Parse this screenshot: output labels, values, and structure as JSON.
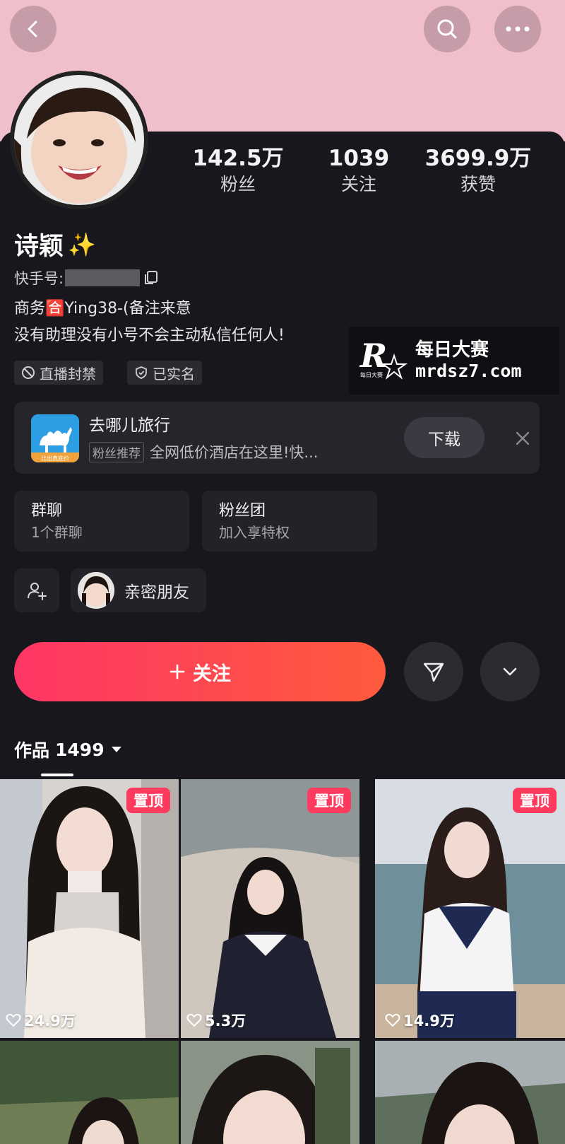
{
  "header": {
    "back_icon": "chevron-left-icon",
    "search_icon": "search-icon",
    "more_icon": "more-horizontal-icon"
  },
  "profile": {
    "stats": [
      {
        "value": "142.5万",
        "label": "粉丝"
      },
      {
        "value": "1039",
        "label": "关注"
      },
      {
        "value": "3699.9万",
        "label": "获赞"
      }
    ],
    "name": "诗颖",
    "name_emoji": "✨",
    "kuaishou_id_label": "快手号:",
    "bio_line1": "商务🈴Ying38-(备注来意",
    "bio_line2": "没有助理没有小号不会主动私信任何人!",
    "tags": [
      {
        "label": "直播封禁",
        "icon": "ban-icon"
      },
      {
        "label": "已实名",
        "icon": "shield-check-icon"
      }
    ]
  },
  "watermark": {
    "logo": "R",
    "logo_sub": "每日大赛",
    "title": "每日大赛",
    "url": "mrdsz7.com"
  },
  "ad": {
    "app_name": "去哪儿旅行",
    "app_icon_caption": "比出真底价",
    "badge": "粉丝推荐",
    "description": "全网低价酒店在这里!快...",
    "download_label": "下载"
  },
  "cards": {
    "group_chat": {
      "title": "群聊",
      "subtitle": "1个群聊"
    },
    "fan_club": {
      "title": "粉丝团",
      "subtitle": "加入享特权"
    }
  },
  "friends": {
    "close_friends_label": "亲密朋友"
  },
  "actions": {
    "follow_label": "关注"
  },
  "works": {
    "tab_label": "作品",
    "count": "1499",
    "items": [
      {
        "pinned": "置顶",
        "likes": "24.9万"
      },
      {
        "pinned": "置顶",
        "likes": "5.3万"
      },
      {
        "pinned": "置顶",
        "likes": "14.9万"
      }
    ]
  },
  "colors": {
    "banner": "#f1bfcc",
    "background": "#17171d",
    "follow_gradient_start": "#fe3666",
    "follow_gradient_end": "#ff5a3c",
    "pin_badge": "#fe3a5f"
  }
}
